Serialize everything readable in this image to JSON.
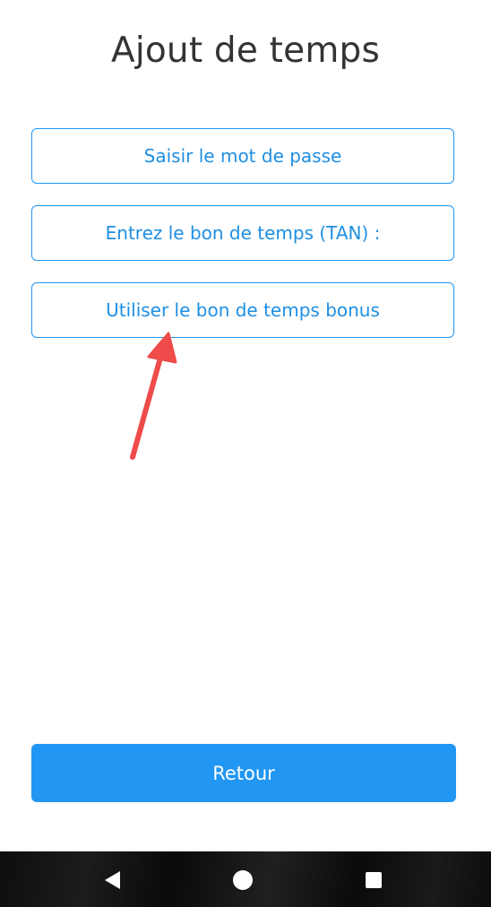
{
  "header": {
    "title": "Ajout de temps"
  },
  "options": [
    {
      "label": "Saisir le mot de passe"
    },
    {
      "label": "Entrez le bon de temps (TAN) :"
    },
    {
      "label": "Utiliser le bon de temps bonus"
    }
  ],
  "footer": {
    "back_label": "Retour"
  },
  "icons": {
    "annotation": "red-arrow-icon",
    "nav_back": "triangle-back-icon",
    "nav_home": "circle-home-icon",
    "nav_recent": "square-recent-icon"
  },
  "colors": {
    "accent": "#2196f3",
    "text_primary": "#333333",
    "annotation": "#ef4b4b",
    "nav_bar": "#111111"
  }
}
